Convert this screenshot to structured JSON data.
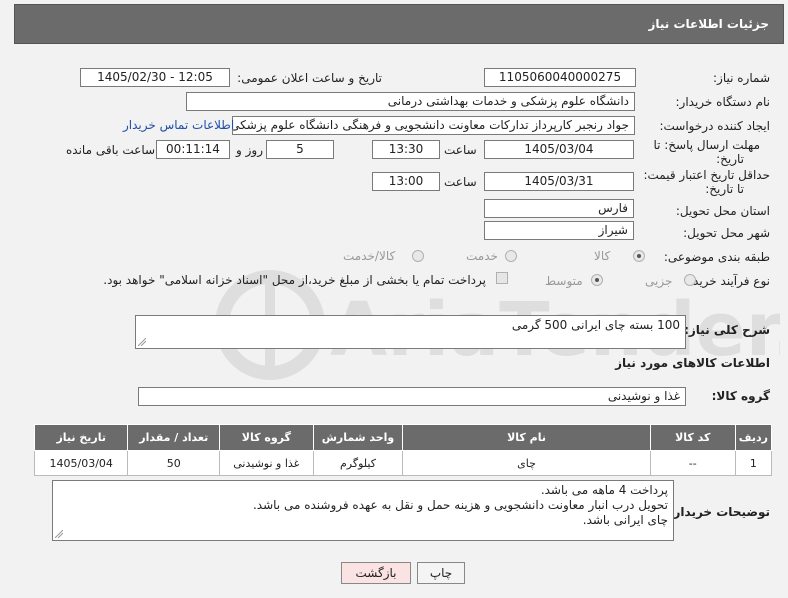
{
  "header": {
    "title": "جزئیات اطلاعات نیاز"
  },
  "fields": {
    "need_number_label": "شماره نیاز:",
    "need_number": "1105060040000275",
    "announce_label": "تاریخ و ساعت اعلان عمومی:",
    "announce_value": "1405/02/30 - 12:05",
    "buyer_org_label": "نام دستگاه خریدار:",
    "buyer_org": "دانشگاه علوم پزشکی و خدمات بهداشتی درمانی",
    "requester_label": "ایجاد کننده درخواست:",
    "requester": "جواد رنجبر کارپرداز تدارکات معاونت دانشجویی و فرهنگی دانشگاه علوم پزشکی",
    "contact_link": "اطلاعات تماس خریدار",
    "deadline_label_1": "مهلت ارسال پاسخ: تا",
    "deadline_label_2": "تاریخ:",
    "deadline_date": "1405/03/04",
    "hour_label": "ساعت",
    "deadline_time": "13:30",
    "days_value": "5",
    "days_label": "روز و",
    "remaining_value": "00:11:14",
    "remaining_label": "ساعت باقی مانده",
    "price_valid_label_1": "حداقل تاریخ اعتبار قیمت:",
    "price_valid_label_2": "تا تاریخ:",
    "price_valid_date": "1405/03/31",
    "price_valid_time": "13:00",
    "province_label": "استان محل تحویل:",
    "province": "فارس",
    "city_label": "شهر محل تحویل:",
    "city": "شیراز",
    "category_label": "طبقه بندی موضوعی:",
    "category_options": [
      "کالا",
      "خدمت",
      "کالا/خدمت"
    ],
    "process_label": "نوع فرآیند خرید :",
    "process_options": [
      "جزیی",
      "متوسط"
    ],
    "payment_note": "پرداخت تمام یا بخشی از مبلغ خرید،از محل \"اسناد خزانه اسلامی\" خواهد بود."
  },
  "description": {
    "label": "شرح کلی نیاز:",
    "value": "100 بسته چای ایرانی 500 گرمی"
  },
  "goods": {
    "section_title": "اطلاعات کالاهای مورد نیاز",
    "group_label": "گروه کالا:",
    "group_value": "غذا و نوشیدنی",
    "columns": [
      "ردیف",
      "کد کالا",
      "نام کالا",
      "واحد شمارش",
      "گروه کالا",
      "تعداد / مقدار",
      "تاریخ نیاز"
    ],
    "rows": [
      [
        "1",
        "--",
        "چای",
        "کیلوگرم",
        "غذا و نوشیدنی",
        "50",
        "1405/03/04"
      ]
    ]
  },
  "buyer_notes": {
    "label": "توضیحات خریدار:",
    "lines": [
      "پرداخت 4 ماهه می باشد.",
      "تحویل درب انبار معاونت دانشجویی و هزینه حمل و نقل به عهده فروشنده می باشد.",
      "چای ایرانی باشد."
    ]
  },
  "buttons": {
    "print": "چاپ",
    "back": "بازگشت"
  },
  "watermark": {
    "text": "AriaTender.neT"
  },
  "colors": {
    "header_bg": "#6b6b6b",
    "link": "#1f4fa8",
    "back_btn_bg": "#fbe3e3"
  }
}
